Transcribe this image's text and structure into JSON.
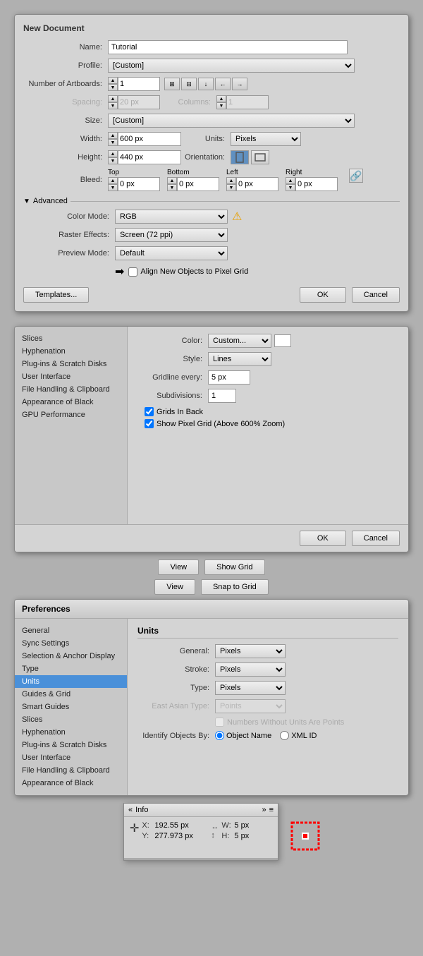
{
  "new_document": {
    "title": "New Document",
    "name_label": "Name:",
    "name_value": "Tutorial",
    "profile_label": "Profile:",
    "profile_value": "[Custom]",
    "artboards_label": "Number of Artboards:",
    "artboards_value": "1",
    "spacing_label": "Spacing:",
    "spacing_value": "20 px",
    "columns_label": "Columns:",
    "columns_value": "1",
    "size_label": "Size:",
    "size_value": "[Custom]",
    "width_label": "Width:",
    "width_value": "600 px",
    "units_label": "Units:",
    "units_value": "Pixels",
    "height_label": "Height:",
    "height_value": "440 px",
    "orientation_label": "Orientation:",
    "bleed_label": "Bleed:",
    "bleed_top_label": "Top",
    "bleed_top_value": "0 px",
    "bleed_bottom_label": "Bottom",
    "bleed_bottom_value": "0 px",
    "bleed_left_label": "Left",
    "bleed_left_value": "0 px",
    "bleed_right_label": "Right",
    "bleed_right_value": "0 px",
    "advanced_label": "Advanced",
    "color_mode_label": "Color Mode:",
    "color_mode_value": "RGB",
    "raster_effects_label": "Raster Effects:",
    "raster_effects_value": "Screen (72 ppi)",
    "preview_mode_label": "Preview Mode:",
    "preview_mode_value": "Default",
    "align_checkbox_label": "Align New Objects to Pixel Grid",
    "templates_btn": "Templates...",
    "ok_btn": "OK",
    "cancel_btn": "Cancel"
  },
  "grid_preferences": {
    "sidebar_items": [
      "Slices",
      "Hyphenation",
      "Plug-ins & Scratch Disks",
      "User Interface",
      "File Handling & Clipboard",
      "Appearance of Black",
      "GPU Performance"
    ],
    "color_label": "Color:",
    "color_value": "Custom...",
    "style_label": "Style:",
    "style_value": "Lines",
    "gridline_label": "Gridline every:",
    "gridline_value": "5 px",
    "subdivisions_label": "Subdivisions:",
    "subdivisions_value": "1",
    "grids_in_back_label": "Grids In Back",
    "show_pixel_label": "Show Pixel Grid (Above 600% Zoom)",
    "ok_btn": "OK",
    "cancel_btn": "Cancel"
  },
  "view_buttons": {
    "view1_label": "View",
    "show_grid_label": "Show Grid",
    "view2_label": "View",
    "snap_grid_label": "Snap to Grid"
  },
  "preferences": {
    "title": "Preferences",
    "sidebar_items": [
      "General",
      "Sync Settings",
      "Selection & Anchor Display",
      "Type",
      "Units",
      "Guides & Grid",
      "Smart Guides",
      "Slices",
      "Hyphenation",
      "Plug-ins & Scratch Disks",
      "User Interface",
      "File Handling & Clipboard",
      "Appearance of Black"
    ],
    "active_item": "Units",
    "units_title": "Units",
    "general_label": "General:",
    "general_value": "Pixels",
    "stroke_label": "Stroke:",
    "stroke_value": "Pixels",
    "type_label": "Type:",
    "type_value": "Pixels",
    "east_asian_label": "East Asian Type:",
    "east_asian_value": "Points",
    "no_units_label": "Numbers Without Units Are Points",
    "identify_label": "Identify Objects By:",
    "object_name_label": "Object Name",
    "xml_id_label": "XML ID"
  },
  "info_panel": {
    "title": "Info",
    "x_label": "X:",
    "x_value": "192.55 px",
    "y_label": "Y:",
    "y_value": "277.973 px",
    "w_label": "W:",
    "w_value": "5 px",
    "h_label": "H:",
    "h_value": "5 px",
    "chevron_left": "«",
    "chevron_right": "»",
    "menu_icon": "≡"
  }
}
